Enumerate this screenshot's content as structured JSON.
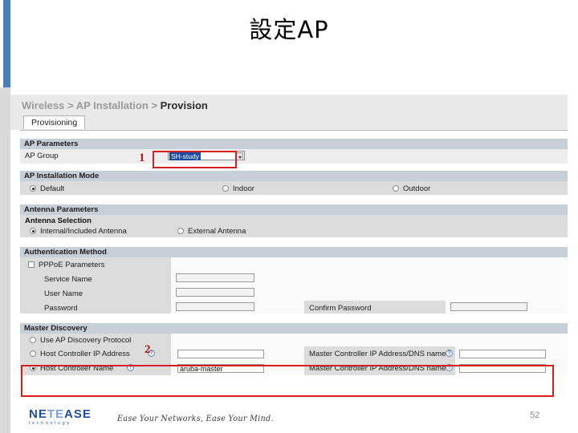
{
  "slide": {
    "title": "設定AP",
    "page_number": "52",
    "accent_blue": "#4a7ebb",
    "annotation_red": "#d91c1c"
  },
  "screenshot": {
    "breadcrumb": {
      "root": "Wireless",
      "sep1": ">",
      "middle": "AP Installation",
      "sep2": ">",
      "current": "Provision"
    },
    "tab": {
      "label": "Provisioning"
    },
    "ap_parameters": {
      "header": "AP Parameters",
      "ap_group_label": "AP Group",
      "ap_group_value": "SH-study"
    },
    "install_mode": {
      "header": "AP Installation Mode",
      "options": [
        {
          "label": "Default",
          "selected": true
        },
        {
          "label": "Indoor",
          "selected": false
        },
        {
          "label": "Outdoor",
          "selected": false
        }
      ]
    },
    "antenna": {
      "header": "Antenna Parameters",
      "subhead": "Antenna Selection",
      "options": [
        {
          "label": "Internal/Included Antenna",
          "selected": true
        },
        {
          "label": "External Antenna",
          "selected": false
        }
      ]
    },
    "auth": {
      "header": "Authentication Method",
      "pppoe_label": "PPPoE Parameters",
      "pppoe_checked": false,
      "fields": [
        {
          "label": "Service Name",
          "value": ""
        },
        {
          "label": "User Name",
          "value": ""
        },
        {
          "label": "Password",
          "value": ""
        }
      ],
      "confirm_label": "Confirm Password",
      "confirm_value": ""
    },
    "master_discovery": {
      "header": "Master Discovery",
      "discovery_protocol_label": "Use AP Discovery Protocol",
      "discovery_protocol_selected": false,
      "rows": [
        {
          "label": "Host Controller IP Address",
          "selected": false,
          "value": "",
          "right_label": "Master Controller IP Address/DNS name",
          "right_value": "",
          "help": "?"
        },
        {
          "label": "Host Controller Name",
          "selected": true,
          "value": "aruba-master",
          "right_label": "Master Controller IP Address/DNS name",
          "right_value": "",
          "help": "?"
        }
      ]
    }
  },
  "annotations": [
    {
      "number": "1"
    },
    {
      "number": "2"
    }
  ],
  "footer": {
    "logo_a": "NE",
    "logo_b": "TE",
    "logo_c": "ASE",
    "logo_sub": "technology",
    "tagline": "Ease Your Networks, Ease Your Mind."
  }
}
